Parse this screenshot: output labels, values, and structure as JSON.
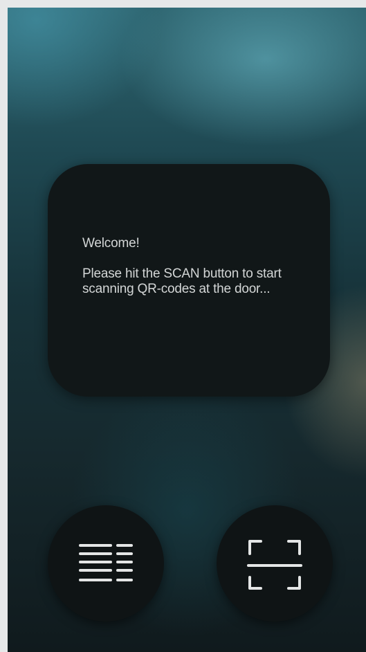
{
  "message": {
    "welcome": "Welcome!",
    "instructions": "Please hit the SCAN button to start scanning QR-codes at the door..."
  },
  "buttons": {
    "menu": {
      "icon": "list-menu-icon"
    },
    "scan": {
      "icon": "qr-scan-icon"
    }
  },
  "colors": {
    "card_background": "#111718",
    "text": "#d3d6d6",
    "icon": "#e4e6e6"
  }
}
